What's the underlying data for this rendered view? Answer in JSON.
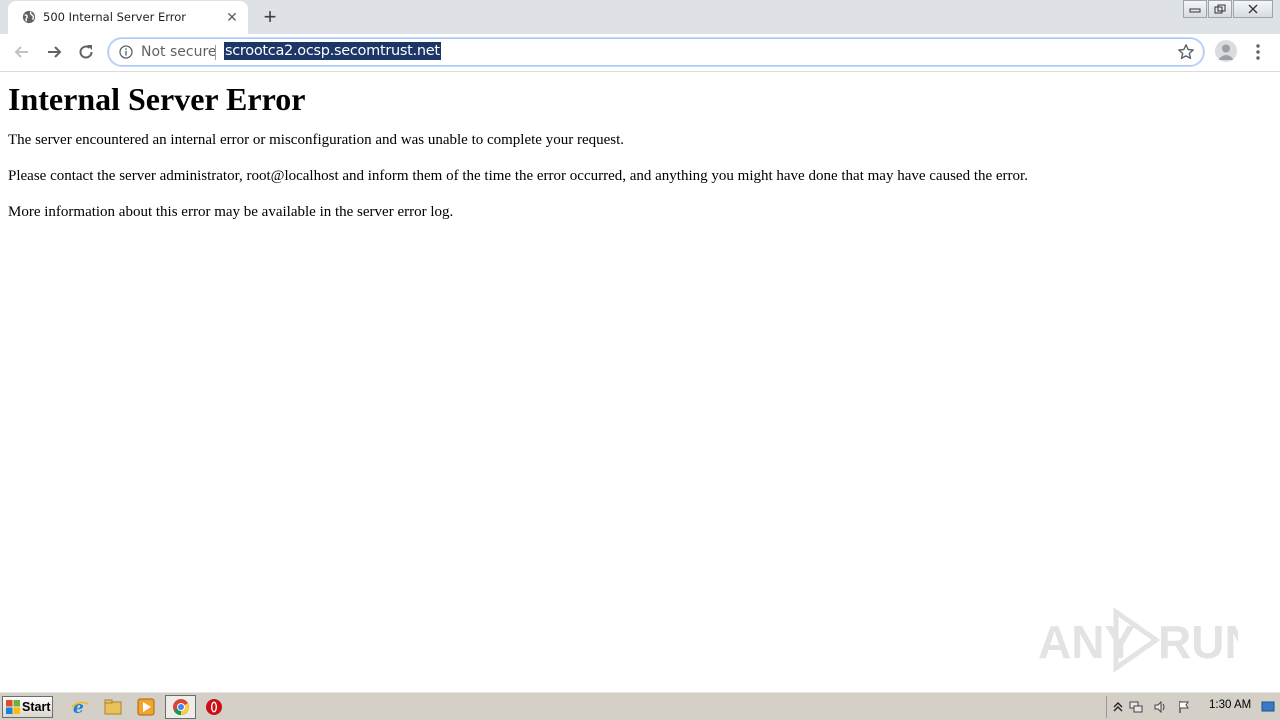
{
  "browser": {
    "tab": {
      "title": "500 Internal Server Error",
      "favicon": "globe-icon",
      "close": "✕"
    },
    "new_tab": "+",
    "window_controls": [
      "minimize-icon",
      "restore-icon",
      "close-icon"
    ],
    "omnibox": {
      "security_label": "Not secure",
      "url": "scrootca2.ocsp.secomtrust.net"
    },
    "accent": "#1b3667"
  },
  "page": {
    "heading": "Internal Server Error",
    "paragraphs": [
      "The server encountered an internal error or misconfiguration and was unable to complete your request.",
      "Please contact the server administrator, root@localhost and inform them of the time the error occurred, and anything you might have done that may have caused the error.",
      "More information about this error may be available in the server error log."
    ]
  },
  "watermark": {
    "text": "ANY RUN"
  },
  "taskbar": {
    "start_label": "Start",
    "pinned": [
      "internet-explorer-icon",
      "folder-icon",
      "media-player-icon",
      "chrome-icon",
      "opera-icon"
    ],
    "clock": "1:30 AM"
  }
}
